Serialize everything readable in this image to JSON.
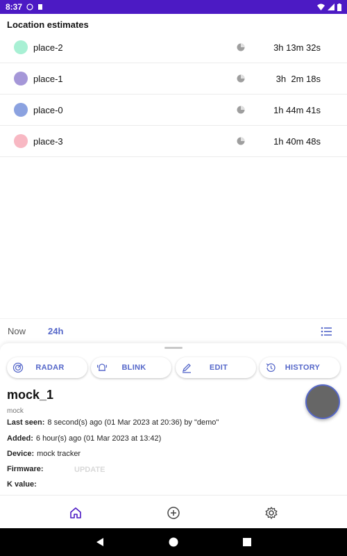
{
  "status_bar": {
    "time": "8:37",
    "background": "#4c1ac4"
  },
  "locations": {
    "title": "Location estimates",
    "items": [
      {
        "name": "place-2",
        "duration": "3h 13m 32s",
        "color": "#a8f0d4"
      },
      {
        "name": "place-1",
        "duration": "3h  2m 18s",
        "color": "#a597d8"
      },
      {
        "name": "place-0",
        "duration": "1h 44m 41s",
        "color": "#8ba2e0"
      },
      {
        "name": "place-3",
        "duration": "1h 40m 48s",
        "color": "#f8b8c3"
      }
    ]
  },
  "time_range": {
    "now_label": "Now",
    "selected_label": "24h"
  },
  "actions": {
    "radar": "RADAR",
    "blink": "BLINK",
    "edit": "EDIT",
    "history": "HISTORY"
  },
  "device": {
    "name": "mock_1",
    "type": "mock",
    "last_seen_label": "Last seen:",
    "last_seen_value": "8 second(s) ago (01 Mar 2023 at 20:36) by \"demo\"",
    "added_label": "Added:",
    "added_value": "6 hour(s) ago (01 Mar 2023 at 13:42)",
    "device_label": "Device:",
    "device_value": "mock tracker",
    "firmware_label": "Firmware:",
    "update_label": "UPDATE",
    "k_label": "K value:"
  },
  "theme": {
    "accent": "#5567c9",
    "nav_active": "#4c1ac4"
  }
}
